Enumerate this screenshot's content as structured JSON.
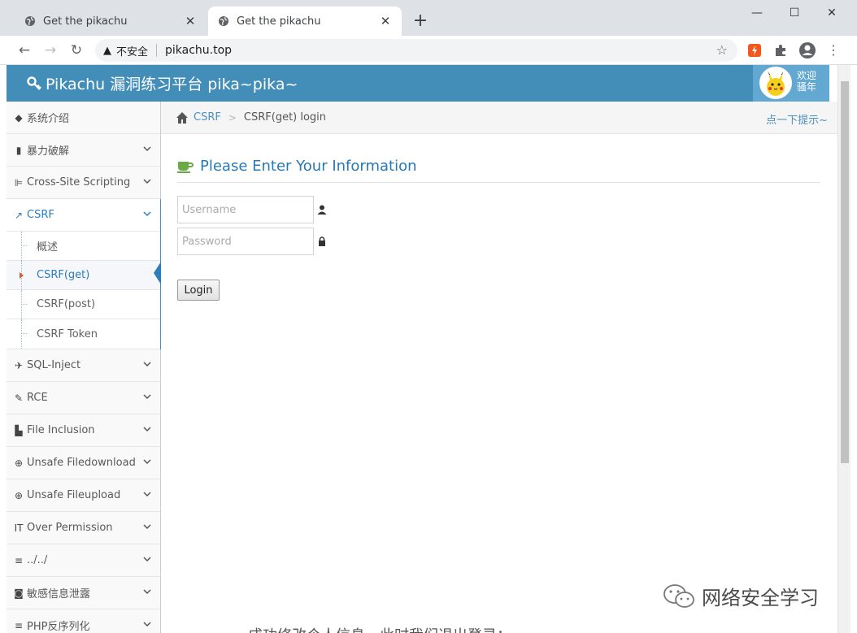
{
  "browser": {
    "tabs": [
      {
        "title": "Get the pikachu",
        "active": false
      },
      {
        "title": "Get the pikachu",
        "active": true
      }
    ],
    "new_tab": "+",
    "window_controls": {
      "minimize": "—",
      "maximize": "☐",
      "close": "✕"
    },
    "address": {
      "security_label": "不安全",
      "url": "pikachu.top"
    }
  },
  "app": {
    "brand": "Pikachu 漏洞练习平台 pika~pika~",
    "welcome_line1": "欢迎",
    "welcome_line2": "骚年",
    "accent_color": "#438eb9"
  },
  "sidebar": {
    "items": [
      {
        "label": "系统介绍",
        "icon": "tags-icon",
        "glyph": "🏷",
        "chevron": false
      },
      {
        "label": "暴力破解",
        "icon": "lock-icon",
        "glyph": "▮",
        "chevron": true
      },
      {
        "label": "Cross-Site Scripting",
        "icon": "sitemap-icon",
        "glyph": "⊫",
        "chevron": true
      },
      {
        "label": "CSRF",
        "icon": "share-icon",
        "glyph": "↗",
        "chevron": true,
        "open": true
      }
    ],
    "csrf_sub": [
      {
        "label": "概述",
        "active": false
      },
      {
        "label": "CSRF(get)",
        "active": true
      },
      {
        "label": "CSRF(post)",
        "active": false
      },
      {
        "label": "CSRF Token",
        "active": false
      }
    ],
    "items_after": [
      {
        "label": "SQL-Inject",
        "icon": "plane-icon",
        "glyph": "✈"
      },
      {
        "label": "RCE",
        "icon": "pencil-icon",
        "glyph": "✎"
      },
      {
        "label": "File Inclusion",
        "icon": "file-icon",
        "glyph": "▙"
      },
      {
        "label": "Unsafe Filedownload",
        "icon": "download-circle-icon",
        "glyph": "⊕"
      },
      {
        "label": "Unsafe Fileupload",
        "icon": "upload-circle-icon",
        "glyph": "⊕"
      },
      {
        "label": "Over Permission",
        "icon": "text-height-icon",
        "glyph": "IT"
      },
      {
        "label": "../../",
        "icon": "align-left-icon",
        "glyph": "≡"
      },
      {
        "label": "敏感信息泄露",
        "icon": "camera-icon",
        "glyph": "◙"
      },
      {
        "label": "PHP反序列化",
        "icon": "align-left-icon",
        "glyph": "≡"
      }
    ]
  },
  "breadcrumb": {
    "parent": "CSRF",
    "current": "CSRF(get) login",
    "tip": "点一下提示~"
  },
  "form": {
    "heading": "Please Enter Your Information",
    "username_placeholder": "Username",
    "password_placeholder": "Password",
    "login_label": "Login"
  },
  "watermark": "网络安全学习",
  "bottom_caption": "成功修改个人信息，此时我们退出登录："
}
